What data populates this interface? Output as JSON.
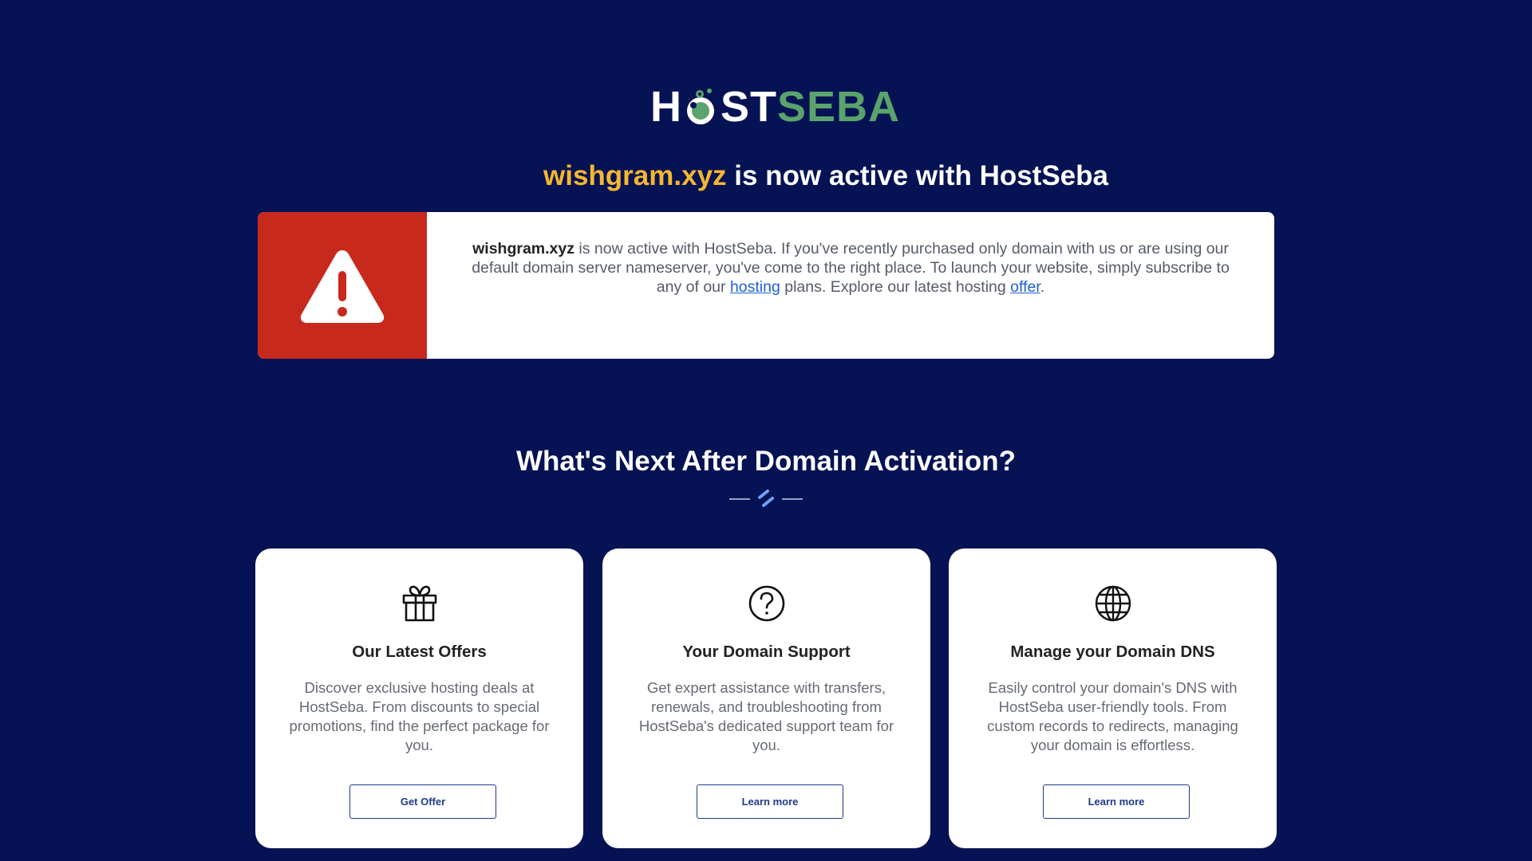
{
  "brand": {
    "logo_part1": "H",
    "logo_part2": "ST",
    "logo_part3": "SEBA",
    "primary_color": "#051253",
    "accent_color": "#f5b631",
    "green_color": "#5aa36c"
  },
  "headline": {
    "domain": "wishgram.xyz",
    "text": " is now active with HostSeba"
  },
  "alert": {
    "icon": "warning-icon",
    "domain": "wishgram.xyz",
    "text_before_hosting": " is now active with HostSeba. If you've recently purchased only domain with us or are using our default domain server nameserver, you've come to the right place. To launch your website, simply subscribe to any of our ",
    "hosting_link": "hosting",
    "text_middle": " plans. Explore our latest hosting ",
    "offer_link": "offer",
    "text_end": "."
  },
  "section": {
    "title": "What's Next After Domain Activation?"
  },
  "cards": [
    {
      "icon": "gift-icon",
      "title": "Our Latest Offers",
      "description": "Discover exclusive hosting deals at HostSeba. From discounts to special promotions, find the perfect package for you.",
      "button": "Get Offer"
    },
    {
      "icon": "question-circle-icon",
      "title": "Your Domain Support",
      "description": "Get expert assistance with transfers, renewals, and troubleshooting from HostSeba's dedicated support team for you.",
      "button": "Learn more"
    },
    {
      "icon": "globe-icon",
      "title": "Manage your Domain DNS",
      "description": "Easily control your domain's DNS with HostSeba user-friendly tools. From custom records to redirects, managing your domain is effortless.",
      "button": "Learn more"
    }
  ]
}
